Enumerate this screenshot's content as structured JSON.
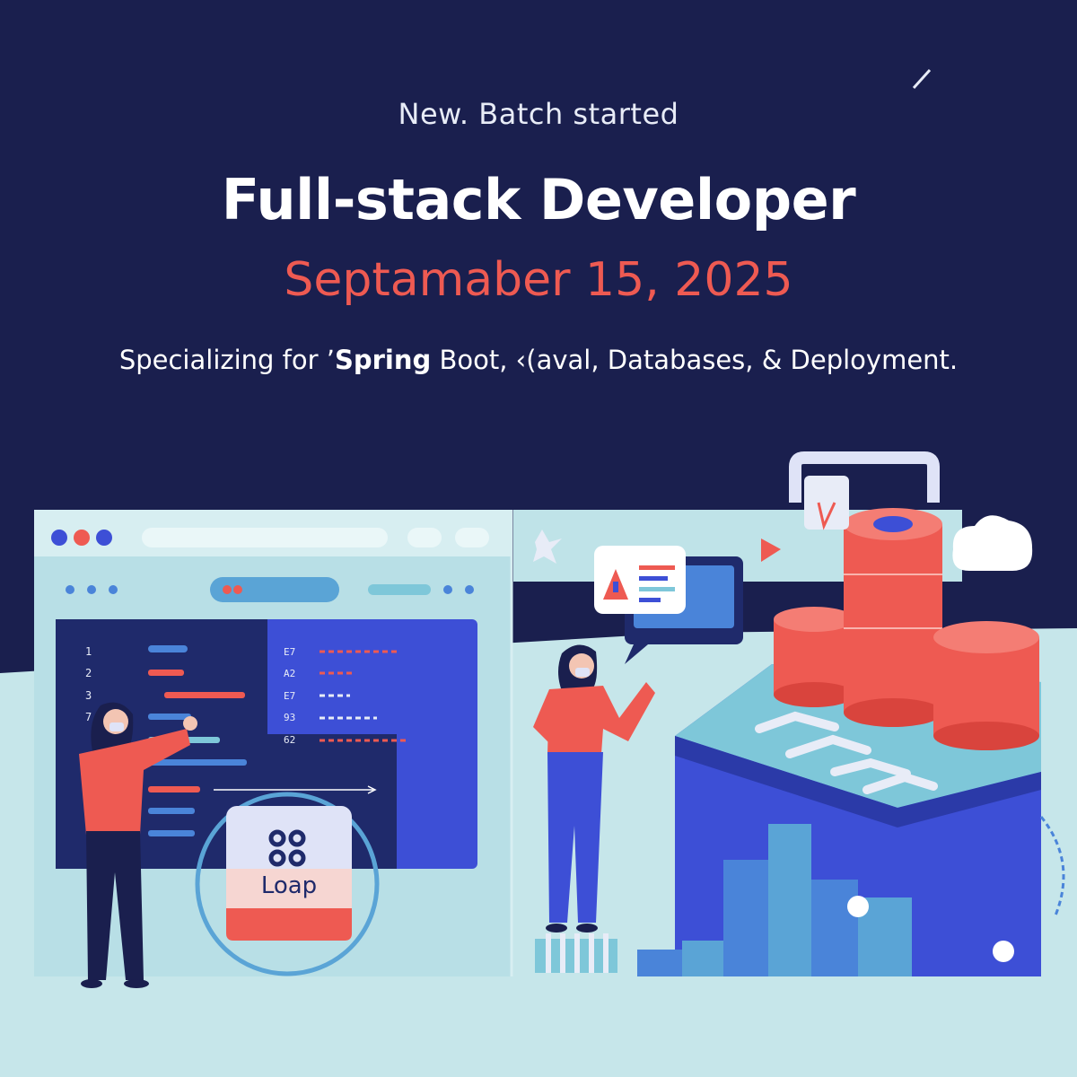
{
  "header": {
    "eyebrow": "New. Batch started",
    "title": "Full-stack Developer",
    "date": "Septamaber 15, 2025",
    "tagline_prefix": "Specializing for ’",
    "tagline_strong": "Spring",
    "tagline_suffix": " Boot, ‹(aval, Databases, & Deployment."
  },
  "editor": {
    "line_numbers": [
      "1",
      "2",
      "3",
      "7"
    ],
    "right_numbers": [
      "E7",
      "A2",
      "E7",
      "93",
      "62"
    ],
    "card_label": "Loap"
  },
  "colors": {
    "background": "#1a1f4e",
    "accent_red": "#ee5a52",
    "accent_blue": "#3d4fd6",
    "light_teal": "#bfe3e8"
  }
}
